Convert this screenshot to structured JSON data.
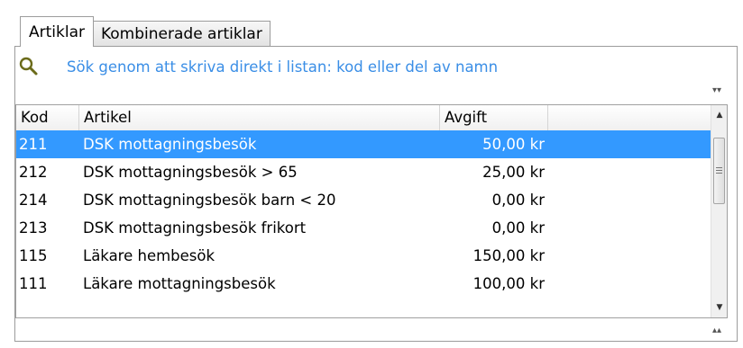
{
  "tabs": [
    {
      "label": "Artiklar",
      "active": true
    },
    {
      "label": "Kombinerade artiklar",
      "active": false
    }
  ],
  "search": {
    "icon": "search-icon",
    "hint": "Sök genom att skriva direkt i listan: kod eller del av namn"
  },
  "grid": {
    "columns": {
      "kod": "Kod",
      "artikel": "Artikel",
      "avgift": "Avgift"
    },
    "rows": [
      {
        "kod": "211",
        "artikel": "DSK mottagningsbesök",
        "avgift": "50,00 kr",
        "selected": true
      },
      {
        "kod": "212",
        "artikel": "DSK mottagningsbesök > 65",
        "avgift": "25,00 kr",
        "selected": false
      },
      {
        "kod": "214",
        "artikel": "DSK mottagningsbesök barn < 20",
        "avgift": "0,00 kr",
        "selected": false
      },
      {
        "kod": "213",
        "artikel": "DSK mottagningsbesök frikort",
        "avgift": "0,00 kr",
        "selected": false
      },
      {
        "kod": "115",
        "artikel": "Läkare hembesök",
        "avgift": "150,00 kr",
        "selected": false
      },
      {
        "kod": "111",
        "artikel": "Läkare mottagningsbesök",
        "avgift": "100,00 kr",
        "selected": false
      }
    ]
  },
  "colors": {
    "selection": "#3399ff",
    "hint_text": "#3a8ee6"
  }
}
